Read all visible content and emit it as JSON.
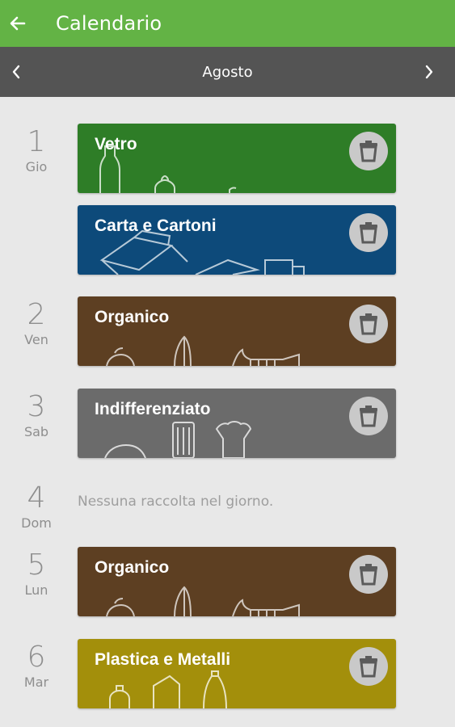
{
  "appbar": {
    "title": "Calendario",
    "back_icon": "arrow-left-icon"
  },
  "month": {
    "label": "Agosto",
    "prev_icon": "chevron-left-icon",
    "next_icon": "chevron-right-icon"
  },
  "colors": {
    "appbar": "#63b345",
    "monthbar": "#545454",
    "vetro": "#2e7d27",
    "carta": "#0d4a7a",
    "organico": "#5d3f22",
    "indifferenziato": "#6b6b6b",
    "plastica": "#a38f0b"
  },
  "days": [
    {
      "num": "1",
      "name": "Gio",
      "items": [
        {
          "label": "Vetro"
        },
        {
          "label": "Carta e Cartoni"
        }
      ]
    },
    {
      "num": "2",
      "name": "Ven",
      "items": [
        {
          "label": "Organico"
        }
      ]
    },
    {
      "num": "3",
      "name": "Sab",
      "items": [
        {
          "label": "Indifferenziato"
        }
      ]
    },
    {
      "num": "4",
      "name": "Dom",
      "empty_text": "Nessuna raccolta nel giorno."
    },
    {
      "num": "5",
      "name": "Lun",
      "items": [
        {
          "label": "Organico"
        }
      ]
    },
    {
      "num": "6",
      "name": "Mar",
      "items": [
        {
          "label": "Plastica e Metalli"
        }
      ]
    }
  ]
}
